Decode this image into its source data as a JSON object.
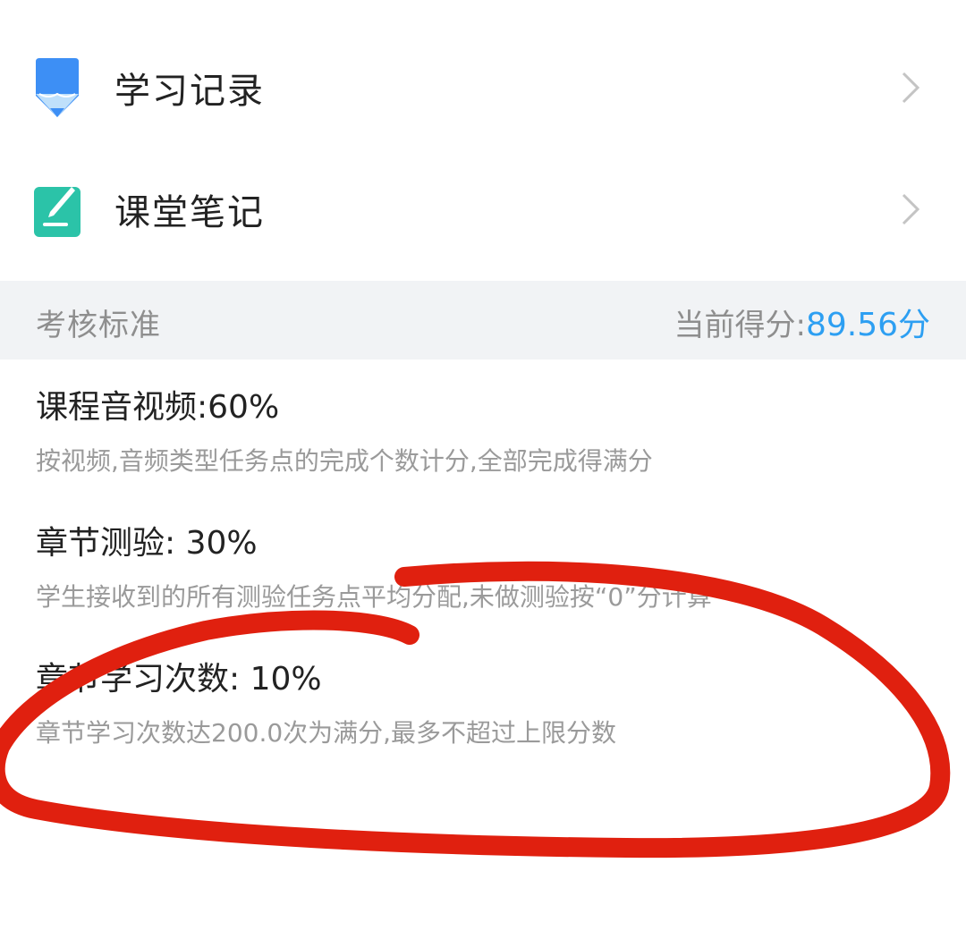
{
  "menu": {
    "items": [
      {
        "label": "学习记录",
        "icon": "pencil-icon",
        "icon_color": "#3d8ff5"
      },
      {
        "label": "课堂笔记",
        "icon": "note-icon",
        "icon_color": "#2bc3a8"
      }
    ]
  },
  "assessment": {
    "title": "考核标准",
    "score_label": "当前得分:",
    "score_value": "89.56分",
    "score_color": "#2d9ff2",
    "criteria": [
      {
        "title": "课程音视频:60%",
        "description": "按视频,音频类型任务点的完成个数计分,全部完成得满分"
      },
      {
        "title": "章节测验: 30%",
        "description": "学生接收到的所有测验任务点平均分配,未做测验按“0”分计算"
      },
      {
        "title": "章节学习次数: 10%",
        "description": "章节学习次数达200.0次为满分,最多不超过上限分数"
      }
    ]
  },
  "annotation_color": "#e0200f"
}
